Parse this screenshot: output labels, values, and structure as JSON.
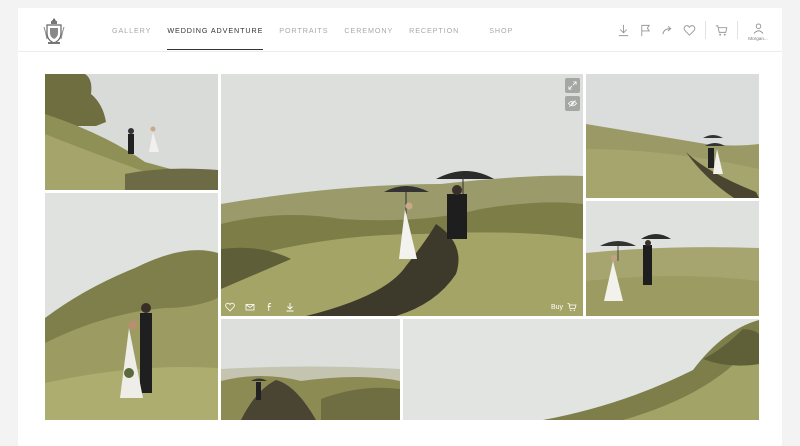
{
  "nav": {
    "items": [
      {
        "label": "GALLERY",
        "active": false
      },
      {
        "label": "WEDDING ADVENTURE",
        "active": true
      },
      {
        "label": "PORTRAITS",
        "active": false
      },
      {
        "label": "CEREMONY",
        "active": false
      },
      {
        "label": "RECEPTION",
        "active": false
      },
      {
        "label": "SHOP",
        "active": false
      }
    ]
  },
  "actions": {
    "icons": [
      "download-icon",
      "flag-icon",
      "share-icon",
      "heart-icon",
      "cart-icon"
    ],
    "user_name": "Morgan..."
  },
  "featured_photo": {
    "overlay_icons": [
      "expand-icon",
      "eye-icon"
    ],
    "bottom_icons": [
      "heart-icon",
      "mail-icon",
      "facebook-icon",
      "download-icon"
    ],
    "buy_label": "Buy"
  },
  "colors": {
    "sky": "#dcdfdc",
    "hill": "#8a8b52",
    "grass": "#a6a66a",
    "path": "#3e3a2c"
  }
}
